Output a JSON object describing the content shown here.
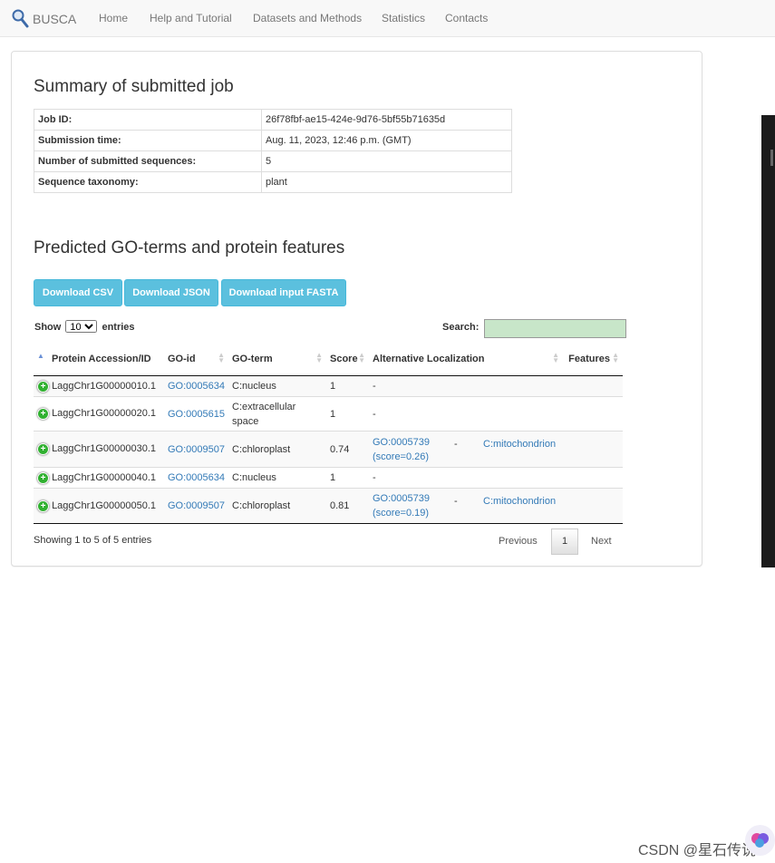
{
  "nav": {
    "brand": "BUSCA",
    "links": [
      "Home",
      "Help and Tutorial",
      "Datasets and Methods",
      "Statistics",
      "Contacts"
    ]
  },
  "summary": {
    "title": "Summary of submitted job",
    "rows": [
      {
        "key": "Job ID:",
        "value": "26f78fbf-ae15-424e-9d76-5bf55b71635d"
      },
      {
        "key": "Submission time:",
        "value": "Aug. 11, 2023, 12:46 p.m. (GMT)"
      },
      {
        "key": "Number of submitted sequences:",
        "value": "5"
      },
      {
        "key": "Sequence taxonomy:",
        "value": "plant"
      }
    ]
  },
  "predicted": {
    "title": "Predicted GO-terms and protein features",
    "buttons": {
      "csv": "Download CSV",
      "json": "Download JSON",
      "fasta": "Download input FASTA"
    },
    "show_label": "Show",
    "entries_label": "entries",
    "page_length": "10",
    "search_label": "Search:",
    "search_value": "",
    "columns": [
      "Protein Accession/ID",
      "GO-id",
      "GO-term",
      "Score",
      "Alternative Localization",
      "Features"
    ],
    "rows": [
      {
        "id": "LaggChr1G00000010.1",
        "go_id": "GO:0005634",
        "go_term": "C:nucleus",
        "score": "1",
        "alt_go": "-",
        "alt_score": "",
        "alt_dash": "",
        "alt_term": "",
        "features": ""
      },
      {
        "id": "LaggChr1G00000020.1",
        "go_id": "GO:0005615",
        "go_term": "C:extracellular space",
        "score": "1",
        "alt_go": "-",
        "alt_score": "",
        "alt_dash": "",
        "alt_term": "",
        "features": ""
      },
      {
        "id": "LaggChr1G00000030.1",
        "go_id": "GO:0009507",
        "go_term": "C:chloroplast",
        "score": "0.74",
        "alt_go": "GO:0005739",
        "alt_score": "(score=0.26)",
        "alt_dash": "-",
        "alt_term": "C:mitochondrion",
        "features": ""
      },
      {
        "id": "LaggChr1G00000040.1",
        "go_id": "GO:0005634",
        "go_term": "C:nucleus",
        "score": "1",
        "alt_go": "-",
        "alt_score": "",
        "alt_dash": "",
        "alt_term": "",
        "features": ""
      },
      {
        "id": "LaggChr1G00000050.1",
        "go_id": "GO:0009507",
        "go_term": "C:chloroplast",
        "score": "0.81",
        "alt_go": "GO:0005739",
        "alt_score": "(score=0.19)",
        "alt_dash": "-",
        "alt_term": "C:mitochondrion",
        "features": ""
      }
    ],
    "info": "Showing 1 to 5 of 5 entries",
    "pager": {
      "prev": "Previous",
      "current": "1",
      "next": "Next"
    }
  },
  "watermark": "CSDN @星石传说",
  "colors": {
    "button": "#5bc0de",
    "link": "#337ab7",
    "search_bg": "#c8e6c9",
    "expand_icon": "#31b131"
  }
}
